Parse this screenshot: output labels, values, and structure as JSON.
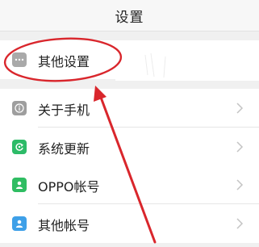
{
  "header": {
    "title": "设置"
  },
  "groups": [
    {
      "items": [
        {
          "label": "其他设置",
          "icon": "more-dots-icon"
        }
      ]
    },
    {
      "items": [
        {
          "label": "关于手机",
          "icon": "info-icon"
        },
        {
          "label": "系统更新",
          "icon": "update-icon"
        }
      ]
    },
    {
      "items": [
        {
          "label": "OPPO帐号",
          "icon": "account-icon"
        },
        {
          "label": "其他帐号",
          "icon": "other-account-icon"
        }
      ]
    }
  ],
  "annotation": {
    "color": "#d9262c"
  },
  "colors": {
    "background": "#f0f0f0",
    "row": "#ffffff",
    "chevron": "#c4c4c4"
  }
}
